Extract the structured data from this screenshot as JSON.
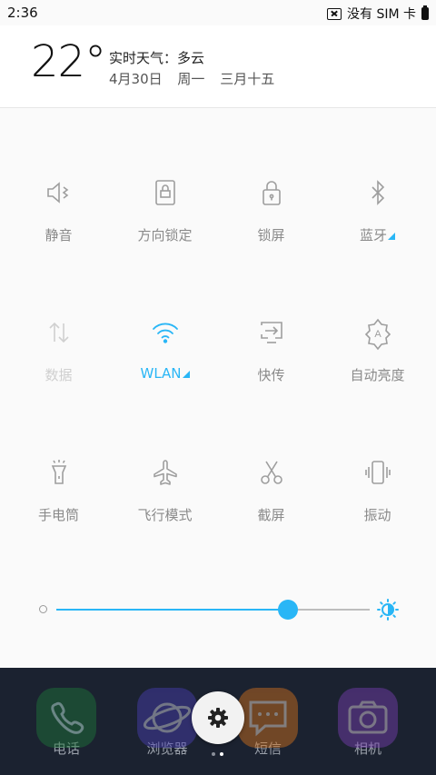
{
  "status": {
    "time": "2:36",
    "no_sim": "没有 SIM 卡"
  },
  "weather": {
    "temp": "22°",
    "desc": "实时天气：多云",
    "date": "4月30日",
    "weekday": "周一",
    "lunar": "三月十五"
  },
  "toggles": [
    {
      "label": "静音",
      "icon": "mute-icon",
      "state": "off"
    },
    {
      "label": "方向锁定",
      "icon": "rotation-lock-icon",
      "state": "off"
    },
    {
      "label": "锁屏",
      "icon": "lock-icon",
      "state": "off"
    },
    {
      "label": "蓝牙",
      "icon": "bluetooth-icon",
      "state": "off",
      "expandable": true
    },
    {
      "label": "数据",
      "icon": "data-icon",
      "state": "disabled"
    },
    {
      "label": "WLAN",
      "icon": "wifi-icon",
      "state": "on",
      "expandable": true
    },
    {
      "label": "快传",
      "icon": "cast-icon",
      "state": "off"
    },
    {
      "label": "自动亮度",
      "icon": "auto-brightness-icon",
      "state": "off"
    },
    {
      "label": "手电筒",
      "icon": "flashlight-icon",
      "state": "off"
    },
    {
      "label": "飞行模式",
      "icon": "airplane-icon",
      "state": "off"
    },
    {
      "label": "截屏",
      "icon": "scissors-icon",
      "state": "off"
    },
    {
      "label": "振动",
      "icon": "vibrate-icon",
      "state": "off"
    }
  ],
  "brightness": {
    "level": 0.74
  },
  "dock": [
    {
      "name": "电话",
      "icon": "phone-icon",
      "color": "#1f7a3a"
    },
    {
      "name": "浏览器",
      "icon": "browser-icon",
      "color": "#4a3fb5"
    },
    {
      "name": "短信",
      "icon": "message-icon",
      "color": "#d9741c"
    },
    {
      "name": "相机",
      "icon": "camera-icon",
      "color": "#7a3fb5"
    }
  ],
  "colors": {
    "accent": "#29b6f6",
    "icon_off": "#9e9e9e",
    "icon_disabled": "#d0d0d0"
  }
}
